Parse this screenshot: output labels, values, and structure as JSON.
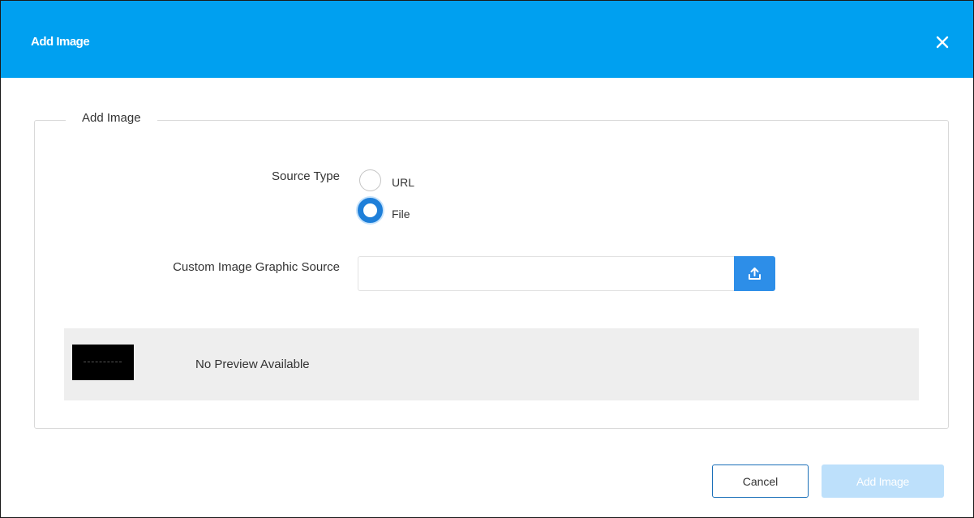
{
  "dialog": {
    "title": "Add Image",
    "close_icon": "close-icon",
    "colors": {
      "header": "#00a0f0",
      "primary": "#1e7fd9",
      "disabled_button": "#bde0fb"
    }
  },
  "form": {
    "legend": "Add Image",
    "source_type_label": "Source Type",
    "source_type_options": [
      {
        "label": "URL",
        "selected": false
      },
      {
        "label": "File",
        "selected": true
      }
    ],
    "custom_source_label": "Custom Image Graphic Source",
    "custom_source_value": "",
    "upload_icon": "upload-icon"
  },
  "preview": {
    "text": "No Preview Available"
  },
  "footer": {
    "cancel_label": "Cancel",
    "add_label": "Add Image",
    "add_disabled": true
  }
}
